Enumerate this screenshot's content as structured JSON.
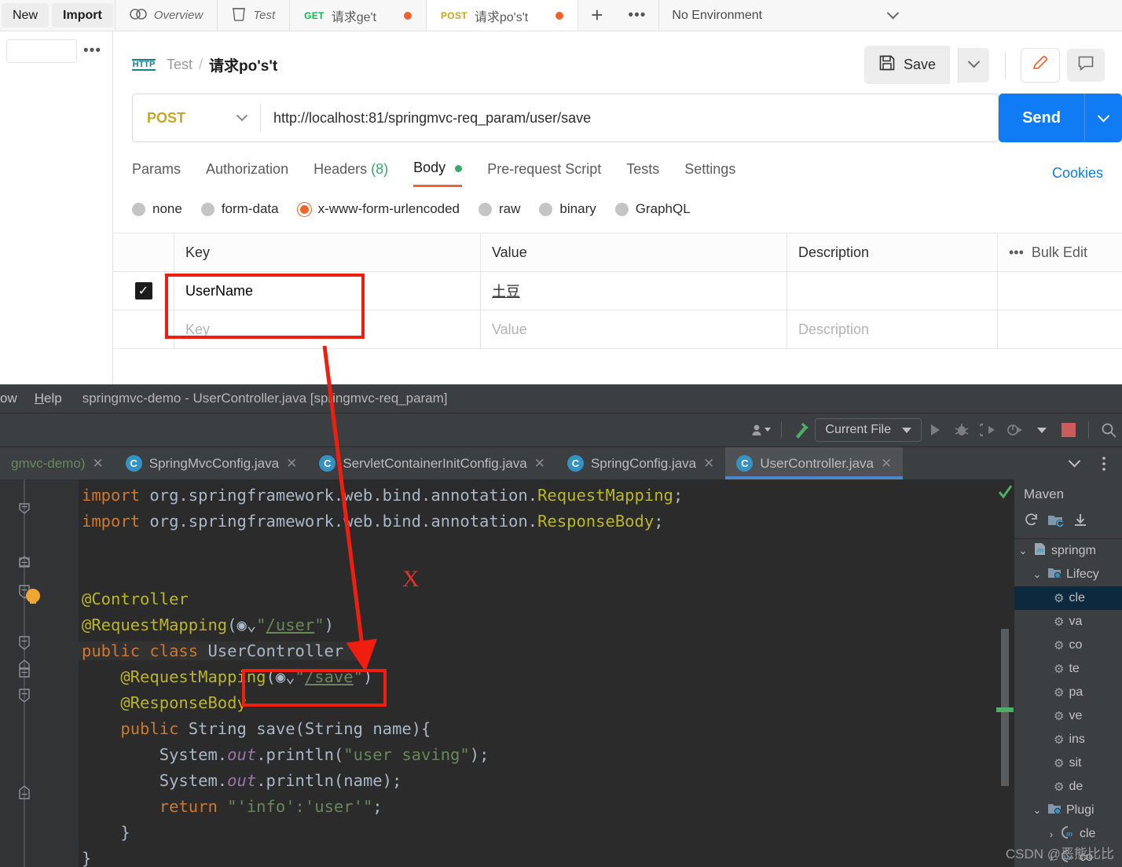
{
  "postman": {
    "topbar": {
      "new_label": "New",
      "import_label": "Import",
      "tabs": [
        {
          "icon": "overview-icon",
          "label": "Overview",
          "method": "",
          "unsaved": false
        },
        {
          "icon": "collection-icon",
          "label": "Test",
          "method": "",
          "unsaved": false
        },
        {
          "icon": "",
          "label": "请求ge't",
          "method": "GET",
          "unsaved": true
        },
        {
          "icon": "",
          "label": "请求po's't",
          "method": "POST",
          "unsaved": true
        }
      ],
      "add_label": "+",
      "more_label": "•••",
      "environment": "No Environment"
    },
    "sidebar": {
      "more_label": "•••"
    },
    "breadcrumb": {
      "protocol_icon": "HTTP",
      "collection": "Test",
      "separator": "/",
      "request": "请求po's't"
    },
    "actions": {
      "save_label": "Save",
      "save_icon": "floppy-disk-icon",
      "save_caret_icon": "chevron-down-icon",
      "edit_icon": "pencil-icon",
      "comment_icon": "comment-icon"
    },
    "request": {
      "method": "POST",
      "url": "http://localhost:81/springmvc-req_param/user/save",
      "send_label": "Send"
    },
    "req_tabs": [
      {
        "label": "Params",
        "active": false
      },
      {
        "label": "Authorization",
        "active": false
      },
      {
        "label": "Headers",
        "count": "(8)",
        "active": false
      },
      {
        "label": "Body",
        "active": true,
        "dot": true
      },
      {
        "label": "Pre-request Script",
        "active": false
      },
      {
        "label": "Tests",
        "active": false
      },
      {
        "label": "Settings",
        "active": false
      }
    ],
    "cookies_label": "Cookies",
    "body_types": [
      {
        "label": "none",
        "selected": false
      },
      {
        "label": "form-data",
        "selected": false
      },
      {
        "label": "x-www-form-urlencoded",
        "selected": true
      },
      {
        "label": "raw",
        "selected": false
      },
      {
        "label": "binary",
        "selected": false
      },
      {
        "label": "GraphQL",
        "selected": false
      }
    ],
    "table": {
      "headers": {
        "key": "Key",
        "value": "Value",
        "description": "Description",
        "bulk_edit": "Bulk Edit",
        "more": "•••"
      },
      "rows": [
        {
          "checked": true,
          "key": "UserName",
          "value": "土豆",
          "description": ""
        }
      ],
      "placeholder_row": {
        "key": "Key",
        "value": "Value",
        "description": "Description"
      }
    }
  },
  "idea": {
    "menu": [
      "ow",
      "Help"
    ],
    "window_title": "springmvc-demo - UserController.java [springmvc-req_param]",
    "toolbar": {
      "profile_icon": "user-icon",
      "build_icon": "hammer-icon",
      "run_config": "Current File",
      "run_icon": "play-icon",
      "debug_icon": "bug-icon",
      "run_coverage_icon": "run-with-coverage-icon",
      "profiler_icon": "profiler-icon",
      "stop_icon": "stop-icon"
    },
    "editor_tabs": [
      {
        "label": "gmvc-demo)",
        "icon": "",
        "active": false
      },
      {
        "label": "SpringMvcConfig.java",
        "icon": "class-icon",
        "active": false
      },
      {
        "label": "ServletContainerInitConfig.java",
        "icon": "class-icon",
        "active": false
      },
      {
        "label": "SpringConfig.java",
        "icon": "class-icon",
        "active": false
      },
      {
        "label": "UserController.java",
        "icon": "class-icon",
        "active": true
      }
    ],
    "tabs_overflow_icon": "chevron-down-icon",
    "tabs_options_icon": "more-vertical-icon",
    "code_lines": [
      "import org.springframework.web.bind.annotation.RequestMapping;",
      "import org.springframework.web.bind.annotation.ResponseBody;",
      "",
      "",
      "@Controller",
      "@RequestMapping(\"/user\")",
      "public class UserController {",
      "    @RequestMapping(\"/save\")",
      "    @ResponseBody",
      "    public String save(String name){",
      "        System.out.println(\"user saving\");",
      "        System.out.println(name);",
      "        return \"'info':'user'\";",
      "    }",
      "}"
    ],
    "maven": {
      "title": "Maven",
      "tool_icons": [
        "reload-icon",
        "add-folder-icon",
        "download-icon"
      ],
      "tree": [
        {
          "label": "springm",
          "depth": 0,
          "icon": "maven-project-icon",
          "expanded": true
        },
        {
          "label": "Lifecy",
          "depth": 1,
          "icon": "folder-icon",
          "expanded": true
        },
        {
          "label": "cle",
          "depth": 2,
          "icon": "gear-icon",
          "selected": true
        },
        {
          "label": "va",
          "depth": 2,
          "icon": "gear-icon"
        },
        {
          "label": "co",
          "depth": 2,
          "icon": "gear-icon"
        },
        {
          "label": "te",
          "depth": 2,
          "icon": "gear-icon"
        },
        {
          "label": "pa",
          "depth": 2,
          "icon": "gear-icon"
        },
        {
          "label": "ve",
          "depth": 2,
          "icon": "gear-icon"
        },
        {
          "label": "ins",
          "depth": 2,
          "icon": "gear-icon"
        },
        {
          "label": "sit",
          "depth": 2,
          "icon": "gear-icon"
        },
        {
          "label": "de",
          "depth": 2,
          "icon": "gear-icon"
        },
        {
          "label": "Plugi",
          "depth": 1,
          "icon": "folder-icon",
          "expanded": true
        },
        {
          "label": "cle",
          "depth": 2,
          "icon": "plugin-icon",
          "collapsed": true
        },
        {
          "label": "co",
          "depth": 2,
          "icon": "plugin-icon",
          "collapsed": true
        }
      ]
    },
    "watermark": "CSDN @恶熊比比",
    "annotation_x": "X"
  },
  "colors": {
    "accent_orange": "#f4622c",
    "send_blue": "#0f7bf4",
    "annotation_red": "#f01e0e",
    "ide_bg": "#3c3f41",
    "editor_bg": "#2b2b2b"
  }
}
